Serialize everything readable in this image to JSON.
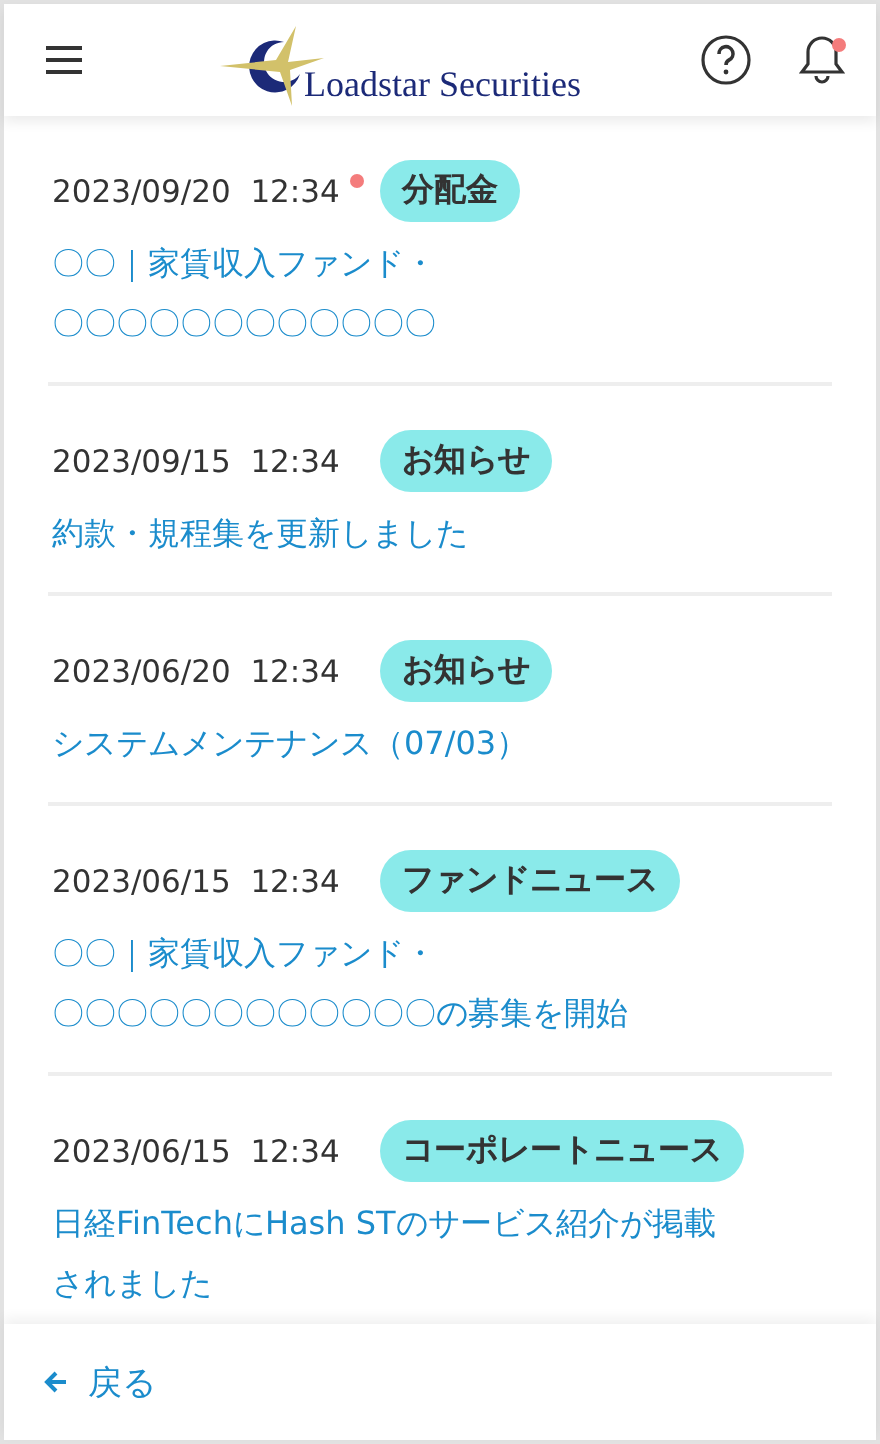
{
  "header": {
    "logo_text": "Loadstar Securities",
    "has_notification": true
  },
  "news": [
    {
      "date": "2023/09/20",
      "time": "12:34",
      "unread": true,
      "category": "分配金",
      "title_lines": [
        "〇〇｜家賃収入ファンド・",
        "〇〇〇〇〇〇〇〇〇〇〇〇"
      ]
    },
    {
      "date": "2023/09/15",
      "time": "12:34",
      "unread": false,
      "category": "お知らせ",
      "title_lines": [
        "約款・規程集を更新しました"
      ]
    },
    {
      "date": "2023/06/20",
      "time": "12:34",
      "unread": false,
      "category": "お知らせ",
      "title_lines": [
        "システムメンテナンス（07/03）"
      ]
    },
    {
      "date": "2023/06/15",
      "time": "12:34",
      "unread": false,
      "category": "ファンドニュース",
      "title_lines": [
        "〇〇｜家賃収入ファンド・",
        "〇〇〇〇〇〇〇〇〇〇〇〇の募集を開始"
      ]
    },
    {
      "date": "2023/06/15",
      "time": "12:34",
      "unread": false,
      "category": "コーポレートニュース",
      "title_lines": [
        "日経FinTechにHash STのサービス紹介が掲載",
        "されました"
      ]
    }
  ],
  "footer": {
    "back_label": "戻る"
  }
}
